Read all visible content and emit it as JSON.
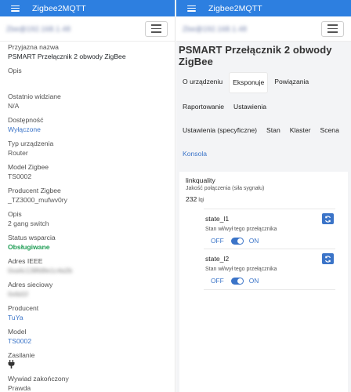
{
  "app": {
    "title": "Zigbee2MQTT"
  },
  "address_blurred": "Zbe@192.168.1.48",
  "left": {
    "fields": [
      {
        "label": "Przyjazna nazwa",
        "value": "PSMART Przełącznik 2 obwody ZigBee",
        "style": "dark"
      },
      {
        "label": "Opis",
        "value": "",
        "style": "dark"
      },
      {
        "label": "Ostatnio widziane",
        "value": "N/A",
        "style": "plain"
      },
      {
        "label": "Dostępność",
        "value": "Wyłączone",
        "style": "link"
      },
      {
        "label": "Typ urządzenia",
        "value": "Router",
        "style": "plain"
      },
      {
        "label": "Model Zigbee",
        "value": "TS0002",
        "style": "plain"
      },
      {
        "label": "Producent Zigbee",
        "value": "_TZ3000_mufwv0ry",
        "style": "plain"
      },
      {
        "label": "Opis",
        "value": "2 gang switch",
        "style": "plain"
      },
      {
        "label": "Status wsparcia",
        "value": "Obsługiwane",
        "style": "green"
      },
      {
        "label": "Adres IEEE",
        "value": "0xa4c138fd9e1c4a2b",
        "style": "blur"
      },
      {
        "label": "Adres sieciowy",
        "value": "0x6d1f",
        "style": "blur"
      },
      {
        "label": "Producent",
        "value": "TuYa",
        "style": "link"
      },
      {
        "label": "Model",
        "value": "TS0002",
        "style": "link"
      },
      {
        "label": "Zasilanie",
        "value": "",
        "style": "icon"
      },
      {
        "label": "Wywiad zakończony",
        "value": "Prawda",
        "style": "plain"
      }
    ]
  },
  "right": {
    "device_title": "PSMART Przełącznik 2 obwody ZigBee",
    "tabs": [
      {
        "label": "O urządzeniu",
        "state": "normal"
      },
      {
        "label": "Eksponuje",
        "state": "active"
      },
      {
        "label": "Powiązania",
        "state": "normal"
      },
      {
        "label": "Raportowanie",
        "state": "normal"
      },
      {
        "label": "Ustawienia",
        "state": "normal"
      },
      {
        "label": "Ustawienia (specyficzne)",
        "state": "normal"
      },
      {
        "label": "Stan",
        "state": "normal"
      },
      {
        "label": "Klaster",
        "state": "normal"
      },
      {
        "label": "Scena",
        "state": "normal"
      },
      {
        "label": "Konsola",
        "state": "link"
      }
    ],
    "linkquality": {
      "title": "linkquality",
      "description": "Jakość połączenia (siła sygnału)",
      "value": "232",
      "unit": "lqi"
    },
    "switches": [
      {
        "name": "state_l1",
        "description": "Stan wł/wył tego przełącznika",
        "off_label": "OFF",
        "on_label": "ON",
        "state": "ON"
      },
      {
        "name": "state_l2",
        "description": "Stan wł/wył tego przełącznika",
        "off_label": "OFF",
        "on_label": "ON",
        "state": "ON"
      }
    ]
  },
  "colors": {
    "topbar": "#2d7fe0",
    "link": "#3b74c8",
    "supported": "#1f9d55"
  }
}
